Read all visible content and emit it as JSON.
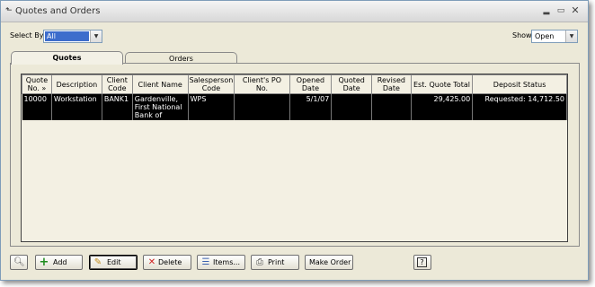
{
  "window": {
    "title": "Quotes and Orders"
  },
  "filters": {
    "select_by_label": "Select By",
    "select_by_value": "All",
    "show_label": "Show",
    "show_value": "Open"
  },
  "tabs": [
    "Quotes",
    "Orders"
  ],
  "table": {
    "columns": [
      "Quote No. »",
      "Description",
      "Client Code",
      "Client Name",
      "Salesperson Code",
      "Client's PO No.",
      "Opened Date",
      "Quoted Date",
      "Revised Date",
      "Est. Quote Total",
      "Deposit Status"
    ],
    "rows": [
      [
        "10000",
        "Workstation",
        "BANK1",
        "Gardenville, First National Bank of",
        "WPS",
        "",
        "5/1/07",
        "",
        "",
        "29,425.00",
        "Requested: 14,712.50"
      ]
    ]
  },
  "toolbar": {
    "add": "Add",
    "edit": "Edit",
    "delete": "Delete",
    "items": "Items...",
    "print": "Print",
    "make_order": "Make Order"
  },
  "colors": {
    "selection": "#000000",
    "accent": "#3d6dcc",
    "window_bg": "#ece9d8"
  }
}
